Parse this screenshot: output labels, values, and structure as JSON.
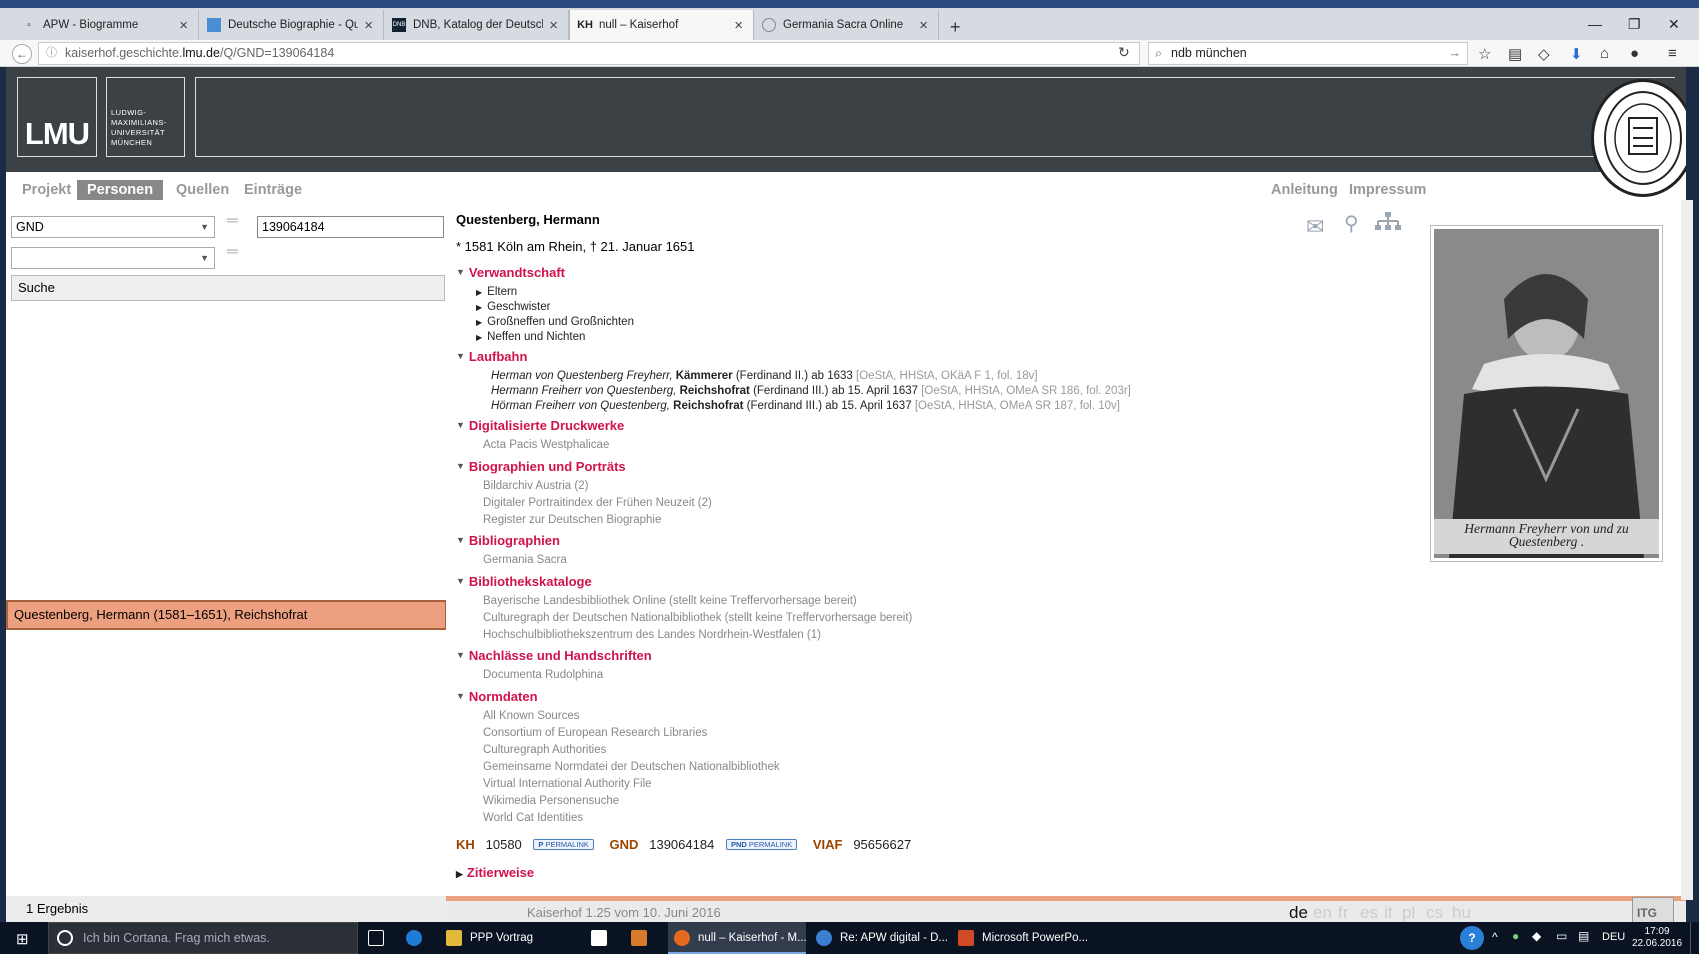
{
  "browser": {
    "tabs": [
      {
        "label": "APW - Biogramme",
        "active": false
      },
      {
        "label": "Deutsche Biographie - Qu...",
        "active": false
      },
      {
        "label": "DNB, Katalog der Deutsch...",
        "active": false
      },
      {
        "label": "null – Kaiserhof",
        "active": true
      },
      {
        "label": "Germania Sacra Online",
        "active": false
      }
    ],
    "url_prefix": "kaiserhof.geschichte.",
    "url_domain": "lmu.de",
    "url_suffix": "/Q/GND=139064184",
    "search_value": "ndb münchen"
  },
  "banner": {
    "logo": "LMU",
    "name_lines": [
      "LUDWIG-",
      "MAXIMILIANS-",
      "UNIVERSITÄT",
      "MÜNCHEN"
    ]
  },
  "nav": {
    "left": [
      "Projekt",
      "Personen",
      "Quellen",
      "Einträge"
    ],
    "active": "Personen",
    "right": [
      "Anleitung",
      "Impressum"
    ]
  },
  "search": {
    "field1": "GND",
    "value1": "139064184",
    "field2": "",
    "submit": "Suche",
    "result": "Questenberg, Hermann (1581–1651), Reichshofrat",
    "count": "1 Ergebnis"
  },
  "person": {
    "name": "Questenberg, Hermann",
    "life": "* 1581 Köln am Rhein, † 21. Januar 1651",
    "portrait_caption_1": "Hermann Freyherr von und zu",
    "portrait_caption_2": "Questenberg ."
  },
  "sections": {
    "verwandtschaft": {
      "title": "Verwandtschaft",
      "items": [
        "Eltern",
        "Geschwister",
        "Großneffen und Großnichten",
        "Neffen und Nichten"
      ]
    },
    "laufbahn": {
      "title": "Laufbahn",
      "entries": [
        {
          "name": "Herman von Questenberg Freyherr,",
          "role": "Kämmerer",
          "rest": "(Ferdinand II.) ab 1633",
          "src": "[OeStA, HHStA, OKäA F 1, fol. 18v]"
        },
        {
          "name": "Hermann Freiherr von Questenberg,",
          "role": "Reichshofrat",
          "rest": "(Ferdinand III.) ab 15. April 1637",
          "src": "[OeStA, HHStA, OMeA SR 186, fol. 203r]"
        },
        {
          "name": "Hörman Freiherr von Questenberg,",
          "role": "Reichshofrat",
          "rest": "(Ferdinand III.) ab 15. April 1637",
          "src": "[OeStA, HHStA, OMeA SR 187, fol. 10v]"
        }
      ]
    },
    "druckwerke": {
      "title": "Digitalisierte Druckwerke",
      "items": [
        "Acta Pacis Westphalicae"
      ]
    },
    "biographien": {
      "title": "Biographien und Porträts",
      "items": [
        "Bildarchiv Austria (2)",
        "Digitaler Portraitindex der Frühen Neuzeit (2)",
        "Register zur Deutschen Biographie"
      ]
    },
    "bibliographien": {
      "title": "Bibliographien",
      "items": [
        "Germania Sacra"
      ]
    },
    "kataloge": {
      "title": "Bibliothekskataloge",
      "items": [
        "Bayerische Landesbibliothek Online (stellt keine Treffervorhersage bereit)",
        "Culturegraph der Deutschen Nationalbibliothek (stellt keine Treffervorhersage bereit)",
        "Hochschulbibliothekszentrum des Landes Nordrhein-Westfalen (1)"
      ]
    },
    "nachlaesse": {
      "title": "Nachlässe und Handschriften",
      "items": [
        "Documenta Rudolphina"
      ]
    },
    "normdaten": {
      "title": "Normdaten",
      "items": [
        "All Known Sources",
        "Consortium of European Research Libraries",
        "Culturegraph Authorities",
        "Gemeinsame Normdatei der Deutschen Nationalbibliothek",
        "Virtual International Authority File",
        "Wikimedia Personensuche",
        "World Cat Identities"
      ]
    }
  },
  "ids": {
    "kh_label": "KH",
    "kh_value": "10580",
    "permalink": "PERMALINK",
    "gnd_label": "GND",
    "gnd_value": "139064184",
    "gnd_badge": "PERMALINK",
    "gnd_badge_prefix": "PND",
    "viaf_label": "VIAF",
    "viaf_value": "95656627"
  },
  "zitierweise": "Zitierweise",
  "footer": {
    "version": "Kaiserhof 1.25 vom 10. Juni 2016",
    "languages": [
      "de",
      "en",
      "fr",
      "es",
      "it",
      "pl",
      "cs",
      "hu"
    ],
    "current_language": "de",
    "itg": "ITG"
  },
  "taskbar": {
    "cortana": "Ich bin Cortana. Frag mich etwas.",
    "apps": [
      "PPP Vortrag",
      "null – Kaiserhof - M...",
      "Re: APW digital - D...",
      "Microsoft PowerPo..."
    ],
    "lang": "DEU",
    "time": "17:09",
    "date": "22.06.2016"
  },
  "colors": {
    "accent": "#d0134a",
    "banner": "#3c4146",
    "result_bg": "#eda07f",
    "id_label": "#9a4500"
  }
}
